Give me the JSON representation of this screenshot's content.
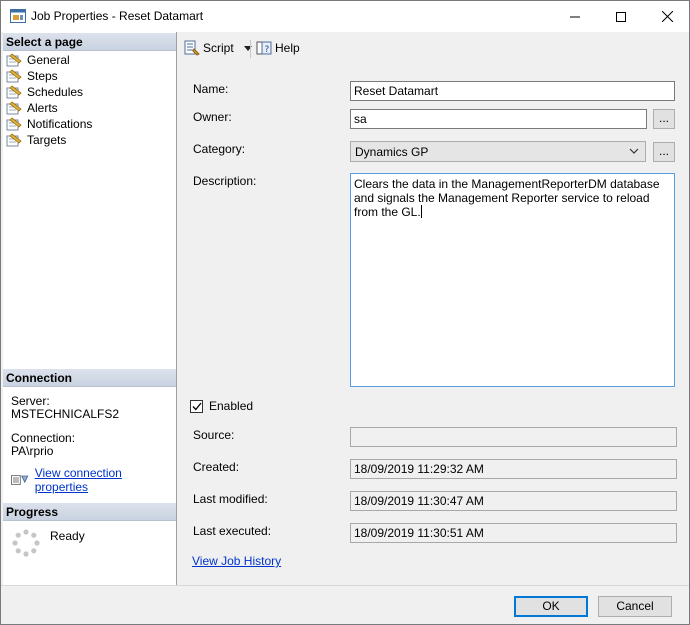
{
  "window": {
    "title": "Job Properties - Reset Datamart"
  },
  "left_pane": {
    "select_page_header": "Select a page",
    "pages": [
      {
        "label": "General",
        "icon": "wrench-page-icon"
      },
      {
        "label": "Steps",
        "icon": "wrench-page-icon"
      },
      {
        "label": "Schedules",
        "icon": "wrench-page-icon"
      },
      {
        "label": "Alerts",
        "icon": "wrench-page-icon"
      },
      {
        "label": "Notifications",
        "icon": "wrench-page-icon"
      },
      {
        "label": "Targets",
        "icon": "wrench-page-icon"
      }
    ],
    "connection_header": "Connection",
    "server_label": "Server:",
    "server_value": "MSTECHNICALFS2",
    "connection_label": "Connection:",
    "connection_value": "PA\\rprio",
    "view_connection_link": "View connection properties",
    "progress_header": "Progress",
    "progress_status": "Ready"
  },
  "toolbar": {
    "script_label": "Script",
    "help_label": "Help"
  },
  "form": {
    "name_label": "Name:",
    "name_value": "Reset Datamart",
    "owner_label": "Owner:",
    "owner_value": "sa",
    "category_label": "Category:",
    "category_value": "Dynamics GP",
    "description_label": "Description:",
    "description_value": "Clears the data in the ManagementReporterDM database and signals the Management Reporter service to reload from the GL.",
    "enabled_label": "Enabled",
    "enabled_checked": true,
    "source_label": "Source:",
    "source_value": "",
    "created_label": "Created:",
    "created_value": "18/09/2019 11:29:32 AM",
    "last_modified_label": "Last modified:",
    "last_modified_value": "18/09/2019 11:30:47 AM",
    "last_executed_label": "Last executed:",
    "last_executed_value": "18/09/2019 11:30:51 AM",
    "view_history_link": "View Job History",
    "ellipsis_label": "..."
  },
  "footer": {
    "ok_label": "OK",
    "cancel_label": "Cancel"
  }
}
